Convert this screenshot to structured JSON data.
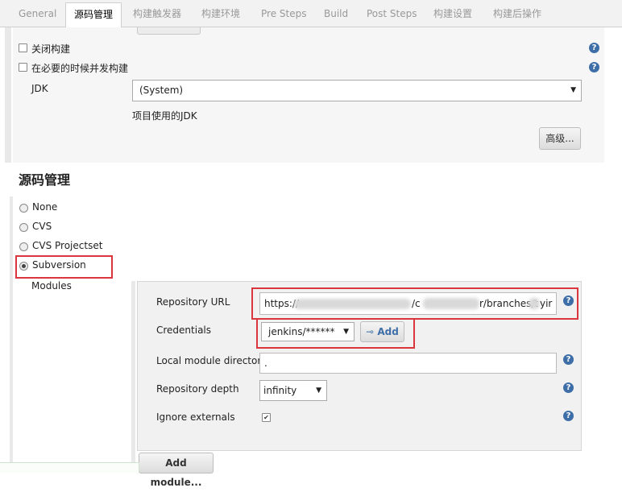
{
  "tabs": [
    "General",
    "源码管理",
    "构建触发器",
    "构建环境",
    "Pre Steps",
    "Build",
    "Post Steps",
    "构建设置",
    "构建后操作"
  ],
  "general": {
    "close_build_label": "关闭构建",
    "concurrent_build_label": "在必要的时候并发构建",
    "jdk_label": "JDK",
    "jdk_value": "(System)",
    "jdk_hint": "项目使用的JDK",
    "advanced_button": "高级..."
  },
  "scm": {
    "title": "源码管理",
    "options": [
      "None",
      "CVS",
      "CVS Projectset",
      "Subversion"
    ],
    "selected": "Subversion",
    "modules_label": "Modules"
  },
  "module": {
    "repo_url_label": "Repository URL",
    "repo_url_value": "https://",
    "repo_url_fragment_a": "/c",
    "repo_url_fragment_b": "r/branches/t",
    "repo_url_fragment_c": "yir",
    "credentials_label": "Credentials",
    "credentials_value": "jenkins/******",
    "add_button": "Add",
    "local_dir_label": "Local module directory",
    "local_dir_value": ".",
    "depth_label": "Repository depth",
    "depth_value": "infinity",
    "ignore_externals_label": "Ignore externals",
    "ignore_externals_checked": true,
    "add_module_button": "Add module..."
  },
  "help_glyph": "?",
  "checkmark_glyph": "✔",
  "colors": {
    "highlight": "#d9363e",
    "help": "#3e6ea8"
  }
}
